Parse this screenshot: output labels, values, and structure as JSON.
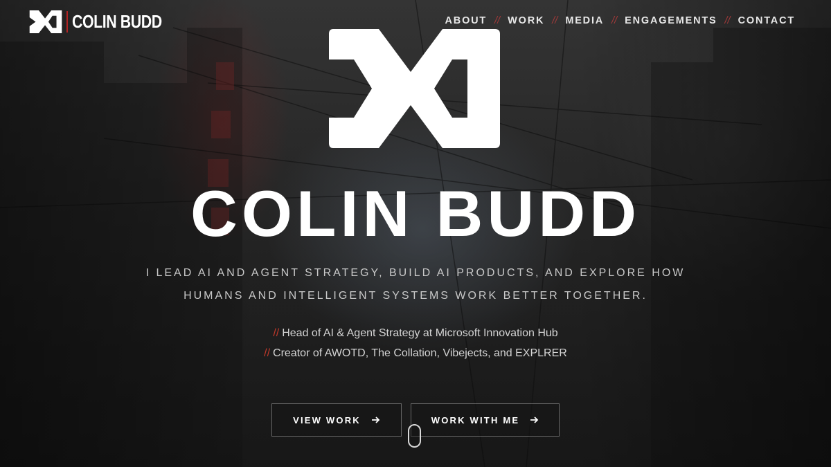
{
  "header": {
    "brand_name": "COLIN BUDD",
    "nav": [
      {
        "label": "ABOUT"
      },
      {
        "label": "WORK"
      },
      {
        "label": "MEDIA"
      },
      {
        "label": "ENGAGEMENTS"
      },
      {
        "label": "CONTACT"
      }
    ],
    "separator": "//"
  },
  "hero": {
    "title": "COLIN BUDD",
    "tagline": "I LEAD AI AND AGENT STRATEGY, BUILD AI PRODUCTS, AND EXPLORE HOW HUMANS AND INTELLIGENT SYSTEMS WORK BETTER TOGETHER.",
    "roles": [
      {
        "prefix": "//",
        "text": "Head of AI & Agent Strategy at Microsoft Innovation Hub"
      },
      {
        "prefix": "//",
        "text": "Creator of AWOTD, The Collation, Vibejects, and EXPLRER"
      }
    ],
    "buttons": {
      "view_work": "VIEW WORK",
      "work_with_me": "WORK WITH ME"
    }
  },
  "icons": {
    "logo": "cb-monogram-icon",
    "button_arrow": "arrow-right-icon",
    "scroll": "scroll-mouse-icon"
  },
  "colors": {
    "accent": "#b32424",
    "text": "#ffffff",
    "muted_text": "#c9c9c9"
  }
}
